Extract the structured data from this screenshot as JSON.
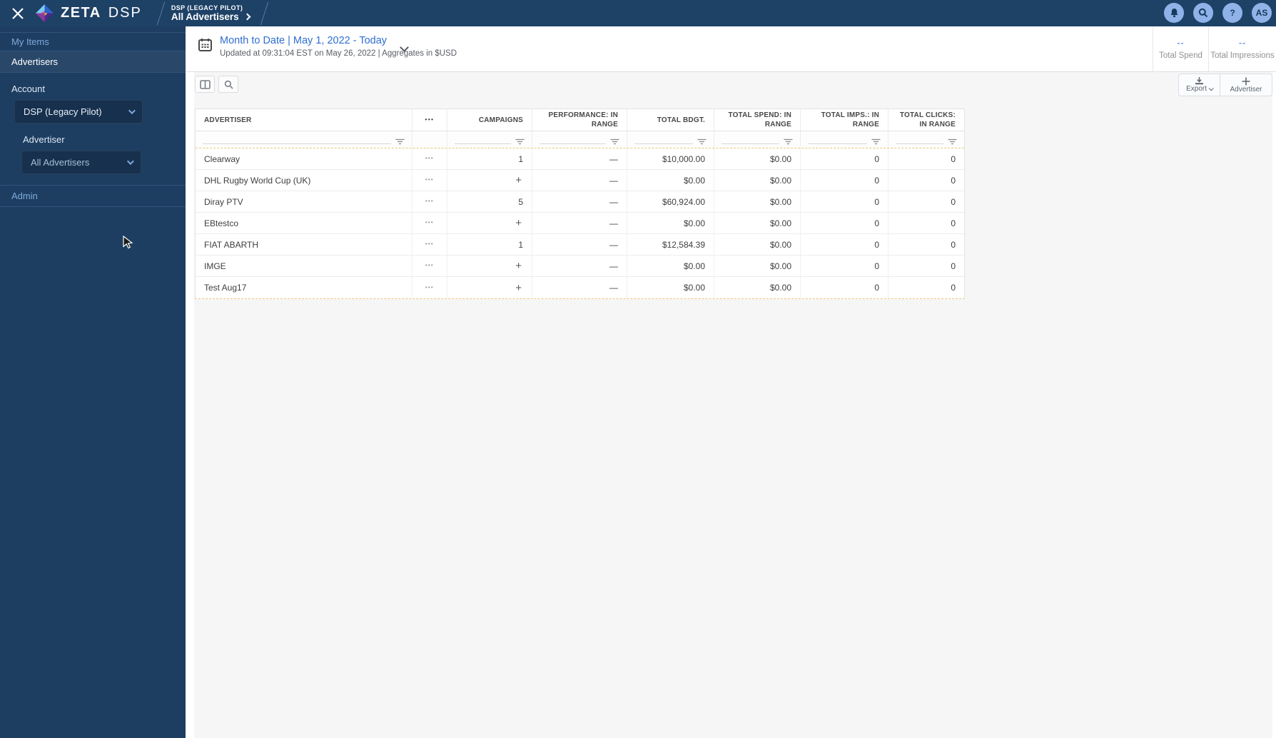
{
  "colors": {
    "topbar_navy": "#1e4166",
    "sidebar_navy": "#1d3e61",
    "select_navy": "#16304e",
    "link_blue": "#2e6fd0",
    "stat_blue": "#6b93e0",
    "sidebar_link_blue": "#7fa9db",
    "circle_blue": "#8fb3e8",
    "panel_gray": "#f6f6f7"
  },
  "icons": [
    "close-icon",
    "zeta-logo-icon",
    "bell-icon",
    "search-icon",
    "help-icon",
    "avatar-badge",
    "calendar-icon",
    "chevron-down-icon",
    "columns-icon",
    "table-search-icon",
    "download-icon",
    "plus-icon",
    "filter-icon",
    "row-menu-icon",
    "mouse-cursor"
  ],
  "topbar": {
    "brand": "ZETA",
    "brand_suffix": "DSP",
    "breadcrumb_small": "DSP (LEGACY PILOT)",
    "breadcrumb_main": "All Advertisers",
    "help": "?",
    "avatar": "AS"
  },
  "sidebar": {
    "my_items": "My Items",
    "advertisers": "Advertisers",
    "account_label": "Account",
    "account_value": "DSP (Legacy Pilot)",
    "advertiser_label": "Advertiser",
    "advertiser_value": "All Advertisers",
    "admin": "Admin"
  },
  "date_header": {
    "title": "Month to Date | May 1, 2022 - Today",
    "subtitle": "Updated at 09:31:04 EST on May 26, 2022 | Aggregates in $USD"
  },
  "stats": {
    "total_spend": {
      "value": "--",
      "label": "Total Spend"
    },
    "total_impressions": {
      "value": "--",
      "label": "Total Impressions"
    }
  },
  "toolbar": {
    "export_label": "Export",
    "advertiser_label": "Advertiser"
  },
  "table": {
    "columns": [
      "ADVERTISER",
      "•••",
      "CAMPAIGNS",
      "PERFORMANCE: IN RANGE",
      "TOTAL BDGT.",
      "TOTAL SPEND: IN RANGE",
      "TOTAL IMPS.: IN RANGE",
      "TOTAL CLICKS: IN RANGE"
    ],
    "row_menu": "•••",
    "row_fields": [
      "advertiser",
      "menu",
      "campaigns",
      "performance",
      "total_budget",
      "total_spend",
      "total_imps",
      "total_clicks"
    ],
    "rows": [
      {
        "advertiser": "Clearway",
        "campaigns": "1",
        "performance": "—",
        "total_budget": "$10,000.00",
        "total_spend": "$0.00",
        "total_imps": "0",
        "total_clicks": "0"
      },
      {
        "advertiser": "DHL Rugby World Cup (UK)",
        "campaigns": "+",
        "performance": "—",
        "total_budget": "$0.00",
        "total_spend": "$0.00",
        "total_imps": "0",
        "total_clicks": "0"
      },
      {
        "advertiser": "Diray PTV",
        "campaigns": "5",
        "performance": "—",
        "total_budget": "$60,924.00",
        "total_spend": "$0.00",
        "total_imps": "0",
        "total_clicks": "0"
      },
      {
        "advertiser": "EBtestco",
        "campaigns": "+",
        "performance": "—",
        "total_budget": "$0.00",
        "total_spend": "$0.00",
        "total_imps": "0",
        "total_clicks": "0"
      },
      {
        "advertiser": "FIAT ABARTH",
        "campaigns": "1",
        "performance": "—",
        "total_budget": "$12,584.39",
        "total_spend": "$0.00",
        "total_imps": "0",
        "total_clicks": "0"
      },
      {
        "advertiser": "IMGE",
        "campaigns": "+",
        "performance": "—",
        "total_budget": "$0.00",
        "total_spend": "$0.00",
        "total_imps": "0",
        "total_clicks": "0"
      },
      {
        "advertiser": "Test Aug17",
        "campaigns": "+",
        "performance": "—",
        "total_budget": "$0.00",
        "total_spend": "$0.00",
        "total_imps": "0",
        "total_clicks": "0"
      }
    ]
  }
}
